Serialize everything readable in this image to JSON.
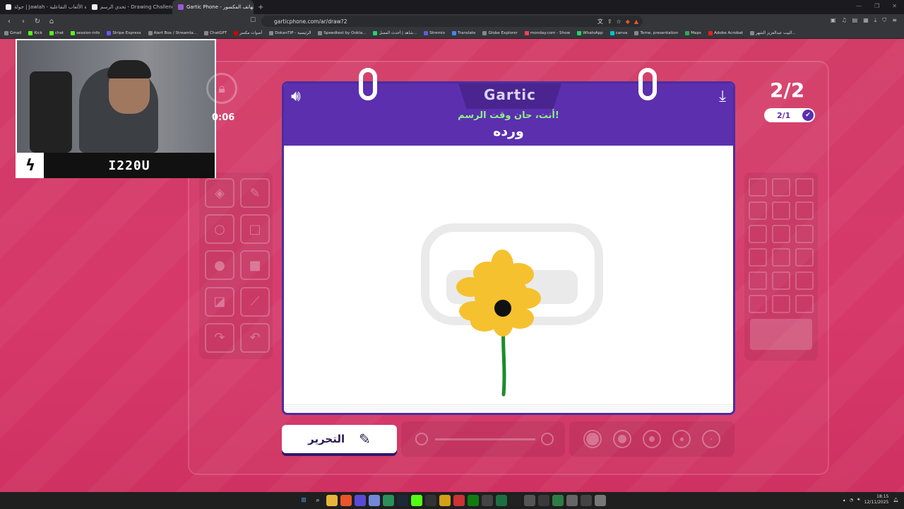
{
  "browser": {
    "tabs": [
      {
        "title": "جولة | Jawlah - منصة الألعاب التفاعلية",
        "active": false
      },
      {
        "title": "تحدي الرسم - Drawing Challenge | جـ",
        "active": false
      },
      {
        "title": "Gartic Phone - لعبة الهاتف المكسور",
        "active": true
      }
    ],
    "new_tab": "+",
    "url": "garticphone.com/ar/draw?2",
    "bookmarks": [
      "Gmail",
      "Kick",
      "chat",
      "session-info",
      "Stripe Express",
      "Alert Box / Streamla...",
      "ChatGPT",
      "أصوات مكسر",
      "DokanTIP - الرئيسية",
      "Speedtest by Ookla...",
      "شاهد | أحدث المسل...",
      "Stremio",
      "Translate",
      "Globe Explorer",
      "monday.com - Show",
      "WhatsApp",
      "canva",
      "Tome, presentation",
      "Maps",
      "Adobe Acrobat",
      "البيت عبدالعزيز الشهر..."
    ]
  },
  "stream": {
    "name": "I220U"
  },
  "game": {
    "logo": "Gartic",
    "timer": "0:06",
    "prompt": "أنت، حان وقت الرسم!",
    "word": "ورده",
    "round": "2/2",
    "round_pill": "2/1",
    "edit_button": "التحرير",
    "drawing": {
      "petal_color": "#f6c12e",
      "center_color": "#111111",
      "stem_color": "#1f8a2e"
    }
  },
  "colors": {
    "background": "#d23d68",
    "card_header": "#5b2fae",
    "prompt_green": "#8ef08a"
  },
  "system": {
    "time": "18:15",
    "date": "12/11/2025"
  }
}
